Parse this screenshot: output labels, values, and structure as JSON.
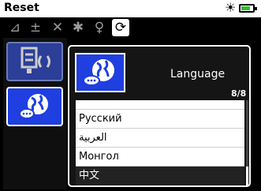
{
  "header": {
    "title": "Reset"
  },
  "tabs": [
    {
      "icon": "balance-icon"
    },
    {
      "icon": "sliders-icon"
    },
    {
      "icon": "tools-icon"
    },
    {
      "icon": "gear-icon"
    },
    {
      "icon": "user-icon"
    },
    {
      "icon": "sync-icon"
    }
  ],
  "dialog": {
    "title": "Language",
    "counter": "8/8",
    "items": [
      {
        "label": ""
      },
      {
        "label": "Русский"
      },
      {
        "label": "العربية"
      },
      {
        "label": "Монгол"
      },
      {
        "label": "中文"
      }
    ]
  },
  "colors": {
    "accent": "#1f3fe0",
    "battery": "#2fbf2f"
  },
  "battery_level": 0.75
}
